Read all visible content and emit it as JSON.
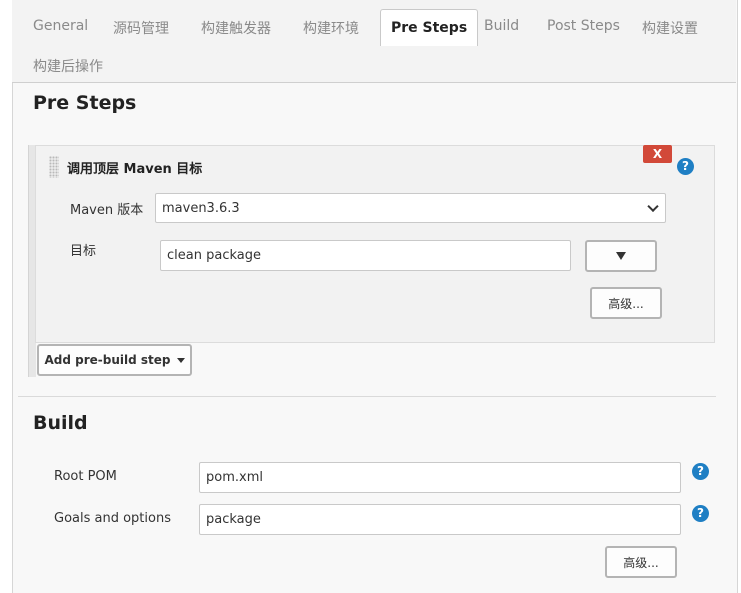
{
  "tabs": [
    {
      "label": "General"
    },
    {
      "label": "源码管理"
    },
    {
      "label": "构建触发器"
    },
    {
      "label": "构建环境"
    },
    {
      "label": "Pre Steps"
    },
    {
      "label": "Build"
    },
    {
      "label": "Post Steps"
    },
    {
      "label": "构建设置"
    },
    {
      "label": "构建后操作"
    }
  ],
  "active_tab": "Pre Steps",
  "pre_steps": {
    "title": "Pre Steps",
    "step": {
      "title": "调用顶层 Maven 目标",
      "delete_label": "X",
      "help_label": "?",
      "maven_version_label": "Maven 版本",
      "maven_version_value": "maven3.6.3",
      "goals_label": "目标",
      "goals_value": "clean package",
      "advanced_label": "高级..."
    },
    "add_step_label": "Add pre-build step"
  },
  "build": {
    "title": "Build",
    "root_pom_label": "Root POM",
    "root_pom_value": "pom.xml",
    "goals_label": "Goals and options",
    "goals_value": "package",
    "help_label": "?",
    "advanced_label": "高级..."
  }
}
